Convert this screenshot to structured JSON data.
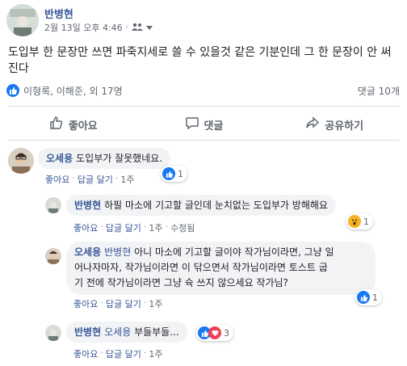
{
  "post": {
    "author": "반병현",
    "timestamp": "2월 13일 오후 4:46",
    "separator": "·",
    "privacy_icon": "friends-icon",
    "text": "도입부 한 문장만 쓰면 파죽지세로 쓸 수 있을것 같은 기분인데 그 한 문장이 안 써진다",
    "reactions_summary": "이형록, 이해준, 외 17명",
    "comments_count": "댓글 10개"
  },
  "actions": {
    "like": "좋아요",
    "comment": "댓글",
    "share": "공유하기"
  },
  "comments": [
    {
      "author": "오세용",
      "text": "도입부가 잘못했네요.",
      "like_label": "좋아요",
      "reply_label": "답글 달기",
      "time": "1주",
      "reaction_count": "1"
    },
    {
      "author": "반병현",
      "text": "하필 마소에 기고할 글인데 눈치없는 도입부가 방해해요",
      "like_label": "좋아요",
      "reply_label": "답글 달기",
      "time": "1주",
      "edited_label": "수정됨",
      "reaction_count": "1"
    },
    {
      "author": "오세용",
      "mention": "반병현",
      "text_line1": "아니 마소에 기고할 글이야 작가님이라면, 그냥 일",
      "text_line2": "어나자마자, 작가님이라면 이 닦으면서 작가님이라면 토스트 굽",
      "text_line3": "기 전에 작가님이라면 그냥 슉 쓰지 않으세요 작가님?",
      "like_label": "좋아요",
      "reply_label": "답글 달기",
      "time": "1주",
      "reaction_count": "1"
    },
    {
      "author": "반병현",
      "mention": "오세용",
      "text": "부들부들...",
      "like_label": "좋아요",
      "reply_label": "답글 달기",
      "time": "1주",
      "reaction_count": "3"
    }
  ],
  "colors": {
    "link": "#385898",
    "like_blue": "#1877f2",
    "bubble_bg": "#f2f3f5",
    "muted": "#606770"
  }
}
